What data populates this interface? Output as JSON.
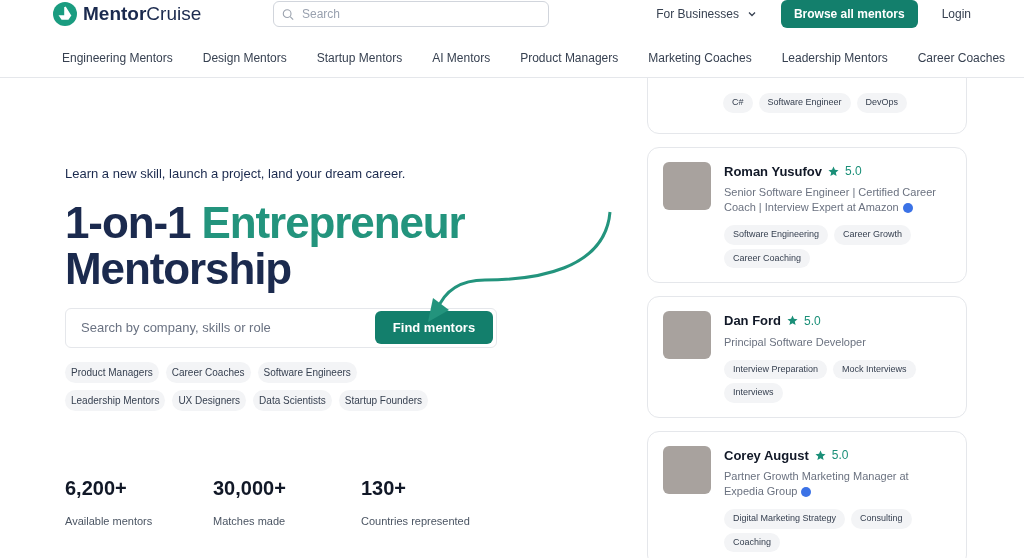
{
  "header": {
    "logo": {
      "bold": "Mentor",
      "light": "Cruise"
    },
    "search": {
      "placeholder": "Search"
    },
    "menu": "For Businesses",
    "cta": "Browse all mentors",
    "login": "Login"
  },
  "nav": [
    "Engineering Mentors",
    "Design Mentors",
    "Startup Mentors",
    "AI Mentors",
    "Product Managers",
    "Marketing Coaches",
    "Leadership Mentors",
    "Career Coaches"
  ],
  "hero": {
    "tagline": "Learn a new skill, launch a project, land your dream career.",
    "heading": [
      {
        "text": "1-on-1 ",
        "accent": false
      },
      {
        "text": "Entrepreneur",
        "accent": true
      },
      {
        "text": "Mentorship",
        "accent": false
      }
    ],
    "search": {
      "placeholder": "Search by company, skills or role",
      "button": "Find mentors"
    },
    "chips": [
      [
        "Product Managers",
        "Career Coaches",
        "Software Engineers"
      ],
      [
        "Leadership Mentors",
        "UX Designers",
        "Data Scientists",
        "Startup Founders"
      ]
    ],
    "stats": [
      {
        "value": "6,200+",
        "label": "Available mentors"
      },
      {
        "value": "30,000+",
        "label": "Matches made"
      },
      {
        "value": "130+",
        "label": "Countries represented"
      }
    ]
  },
  "mentors": [
    {
      "tags": [
        "C#",
        "Software Engineer",
        "DevOps"
      ]
    },
    {
      "name": "Roman Yusufov",
      "rating": "5.0",
      "title": "Senior Software Engineer | Certified Career Coach | Interview Expert at Amazon",
      "verified": true,
      "tags": [
        "Software Engineering",
        "Career Growth",
        "Career Coaching"
      ]
    },
    {
      "name": "Dan Ford",
      "rating": "5.0",
      "title": "Principal Software Developer",
      "verified": false,
      "tags": [
        "Interview Preparation",
        "Mock Interviews",
        "Interviews"
      ]
    },
    {
      "name": "Corey August",
      "rating": "5.0",
      "title": "Partner Growth Marketing Manager at Expedia Group",
      "verified": true,
      "tags": [
        "Digital Marketing Strategy",
        "Consulting",
        "Coaching"
      ]
    }
  ]
}
